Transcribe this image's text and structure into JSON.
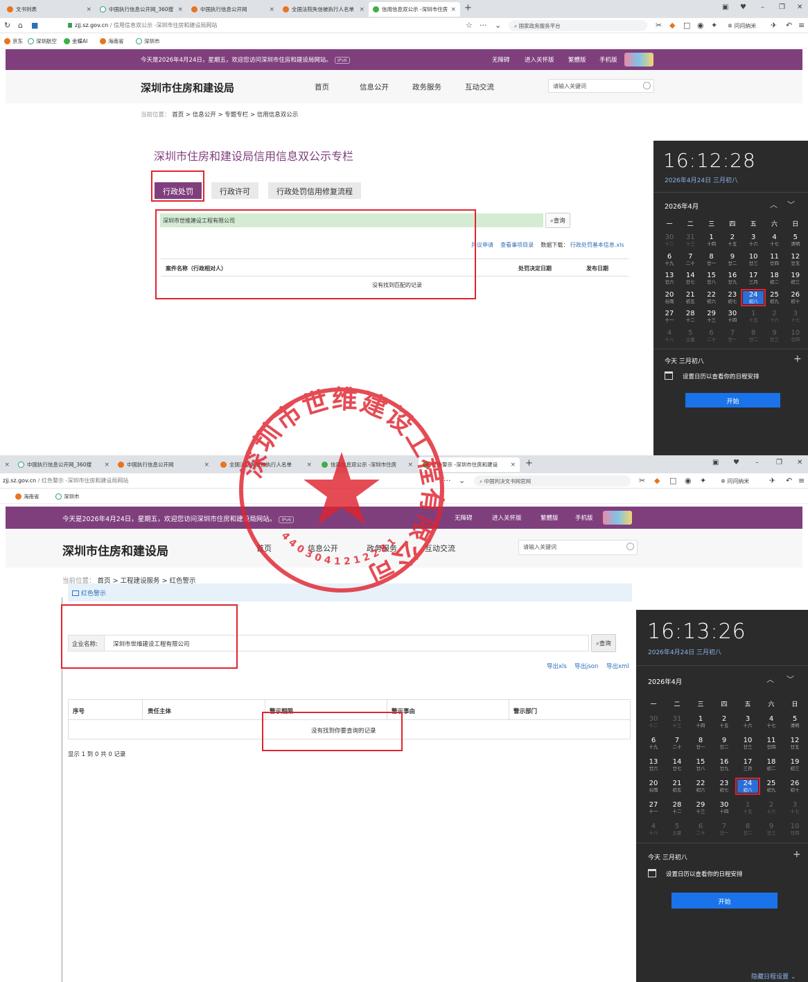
{
  "shot1": {
    "tabs": [
      "文书列表",
      "中国执行信息公开网_360搜",
      "中国执行信息公开网",
      "全国法院失信被执行人名单",
      "信用信息双公示 -深圳市住房"
    ],
    "url_domain": "zjj.sz.gov.cn",
    "url_rest": " / 信用信息双公示 -深圳市住房和建设局网站",
    "search_engine": "国家政务服务平台",
    "ai_label": "问问纳米",
    "bookmarks": [
      "京东",
      "深圳航空",
      "金蝶AI",
      "海南省",
      "深圳市"
    ],
    "welcome": "今天是2026年4月24日，星期五，欢迎您访问深圳市住房和建设局网站。",
    "ipv6": "IPv6",
    "toplinks": [
      "无障碍",
      "进入关怀版",
      "繁體版",
      "手机版"
    ],
    "brand": "深圳市住房和建设局",
    "nav": [
      "首页",
      "信息公开",
      "政务服务",
      "互动交流"
    ],
    "kw_placeholder": "请输入关键词",
    "crumb_prefix": "当前位置：",
    "crumb": "首页 > 信息公开 > 专题专栏 > 信用信息双公示",
    "page_title": "深圳市住房和建设局信用信息双公示专栏",
    "biz_tabs": [
      "行政处罚",
      "行政许可",
      "行政处罚信用修复流程"
    ],
    "search_value": "深圳市世维建设工程有限公司",
    "query_label": "查询",
    "links": [
      "异议申请",
      "查看事项目录"
    ],
    "download_label": "数据下载：",
    "download_file": "行政处罚基本信息.xls",
    "headers": [
      "案件名称（行政相对人）",
      "处罚决定日期",
      "发布日期"
    ],
    "no_record": "没有找到匹配的记录",
    "calendar": {
      "time": "16:12:28",
      "date": "2026年4月24日 三月初八",
      "month": "2026年4月",
      "today_text": "今天 三月初八",
      "schedule_text": "设置日历以查看你的日程安排",
      "start": "开始"
    }
  },
  "shot2": {
    "tabs": [
      "中国执行信息公开网_360搜",
      "中国执行信息公开网",
      "全国法院失信被执行人名单",
      "信用信息双公示 -深圳市住房",
      "红色警示 -深圳市住房和建设"
    ],
    "url_domain": "zjj.sz.gov.cn",
    "url_rest": " / 红色警示 -深圳市住房和建设局网站",
    "search_engine": "中国判决文书网官网",
    "ai_label": "问问纳米",
    "bookmarks": [
      "海南省",
      "深圳市"
    ],
    "welcome": "今天是2026年4月24日，星期五，欢迎您访问深圳市住房和建设局网站。",
    "ipv6": "IPv6",
    "toplinks": [
      "无障碍",
      "进入关怀版",
      "繁體版",
      "手机版"
    ],
    "brand": "深圳市住房和建设局",
    "nav": [
      "首页",
      "信息公开",
      "政务服务",
      "互动交流"
    ],
    "kw_placeholder": "请输入关键词",
    "crumb_prefix": "当前位置：",
    "crumb": "首页 > 工程建设服务 > 红色警示",
    "panel_title": "红色警示",
    "company_label": "企业名称:",
    "company_value": "深圳市世维建设工程有限公司",
    "query_label": "查询",
    "exports": [
      "导出xls",
      "导出json",
      "导出xml"
    ],
    "headers": [
      "序号",
      "责任主体",
      "警示期限",
      "警示事由",
      "警示部门"
    ],
    "no_record": "没有找到你要查询的记录",
    "summary": "显示 1 到 0 共 0 记录",
    "calendar": {
      "time": "16:13:26",
      "date": "2026年4月24日 三月初八",
      "month": "2026年4月",
      "today_text": "今天 三月初八",
      "schedule_text": "设置日历以查看你的日程安排",
      "start": "开始",
      "hide": "隐藏日程设置"
    }
  },
  "calendar_grid": {
    "weekdays": [
      "一",
      "二",
      "三",
      "四",
      "五",
      "六",
      "日"
    ],
    "days": [
      [
        "30",
        "十二"
      ],
      [
        "31",
        "十三"
      ],
      [
        "1",
        "十四"
      ],
      [
        "2",
        "十五"
      ],
      [
        "3",
        "十六"
      ],
      [
        "4",
        "十七"
      ],
      [
        "5",
        "清明"
      ],
      [
        "6",
        "十九"
      ],
      [
        "7",
        "二十"
      ],
      [
        "8",
        "廿一"
      ],
      [
        "9",
        "廿二"
      ],
      [
        "10",
        "廿三"
      ],
      [
        "11",
        "廿四"
      ],
      [
        "12",
        "廿五"
      ],
      [
        "13",
        "廿六"
      ],
      [
        "14",
        "廿七"
      ],
      [
        "15",
        "廿八"
      ],
      [
        "16",
        "廿九"
      ],
      [
        "17",
        "三月"
      ],
      [
        "18",
        "初二"
      ],
      [
        "19",
        "初三"
      ],
      [
        "20",
        "谷雨"
      ],
      [
        "21",
        "初五"
      ],
      [
        "22",
        "初六"
      ],
      [
        "23",
        "初七"
      ],
      [
        "24",
        "初八"
      ],
      [
        "25",
        "初九"
      ],
      [
        "26",
        "初十"
      ],
      [
        "27",
        "十一"
      ],
      [
        "28",
        "十二"
      ],
      [
        "29",
        "十三"
      ],
      [
        "30",
        "十四"
      ],
      [
        "1",
        "十五"
      ],
      [
        "2",
        "十六"
      ],
      [
        "3",
        "十七"
      ],
      [
        "4",
        "十八"
      ],
      [
        "5",
        "立夏"
      ],
      [
        "6",
        "二十"
      ],
      [
        "7",
        "廿一"
      ],
      [
        "8",
        "廿二"
      ],
      [
        "9",
        "廿三"
      ],
      [
        "10",
        "廿四"
      ]
    ],
    "today_index": 25
  },
  "seal": {
    "text": "深圳市世维建设工程有限公司",
    "number": "4403041212281",
    "color": "#e0242f"
  },
  "colors": {
    "brand_purple": "#7f3f7d",
    "link_blue": "#2d6fb8",
    "annotation_red": "#e0242f",
    "calendar_bg": "#2b2b2b"
  }
}
